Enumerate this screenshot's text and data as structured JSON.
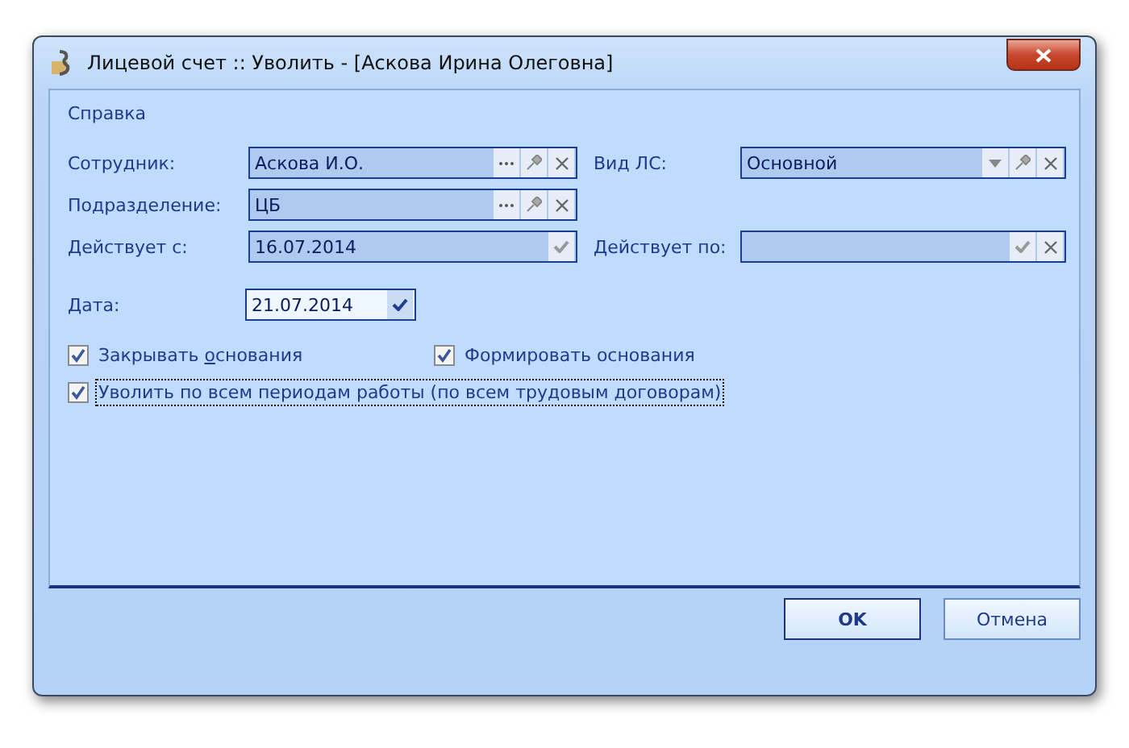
{
  "window": {
    "title": "Лицевой счет :: Уволить - [Аскова Ирина Олеговна]"
  },
  "menu": {
    "label": "Справка"
  },
  "fields": [
    {
      "label": "Сотрудник:",
      "value": "Аскова И.О.",
      "buttons": [
        {
          "kind": "ellipsis"
        },
        {
          "kind": "pin"
        },
        {
          "kind": "clear"
        }
      ]
    },
    {
      "label": "Вид ЛС:",
      "value": "Основной",
      "buttons": [
        {
          "kind": "dropdown"
        },
        {
          "kind": "pin"
        },
        {
          "kind": "clear"
        }
      ]
    },
    {
      "label": "Подразделение:",
      "value": "ЦБ",
      "buttons": [
        {
          "kind": "ellipsis"
        },
        {
          "kind": "pin"
        },
        {
          "kind": "clear"
        }
      ]
    },
    {
      "label": "Действует с:",
      "value": "16.07.2014",
      "buttons": [
        {
          "kind": "check"
        }
      ]
    },
    {
      "label": "Действует по:",
      "buttons": [
        {
          "kind": "check"
        },
        {
          "kind": "clear"
        }
      ]
    }
  ],
  "date": {
    "label": "Дата:",
    "value": "21.07.2014"
  },
  "checkboxes": [
    {
      "label": "Закрывать **о**снования",
      "checked": true,
      "focused": false
    },
    {
      "label": "Формировать основания",
      "checked": true,
      "focused": false
    },
    {
      "label": "Уволить по всем периодам работы (по всем трудовым договорам)",
      "checked": true,
      "focused": true
    }
  ],
  "buttons": [
    {
      "label": "OK",
      "default": true
    },
    {
      "label": "Отмена",
      "default": false
    }
  ]
}
